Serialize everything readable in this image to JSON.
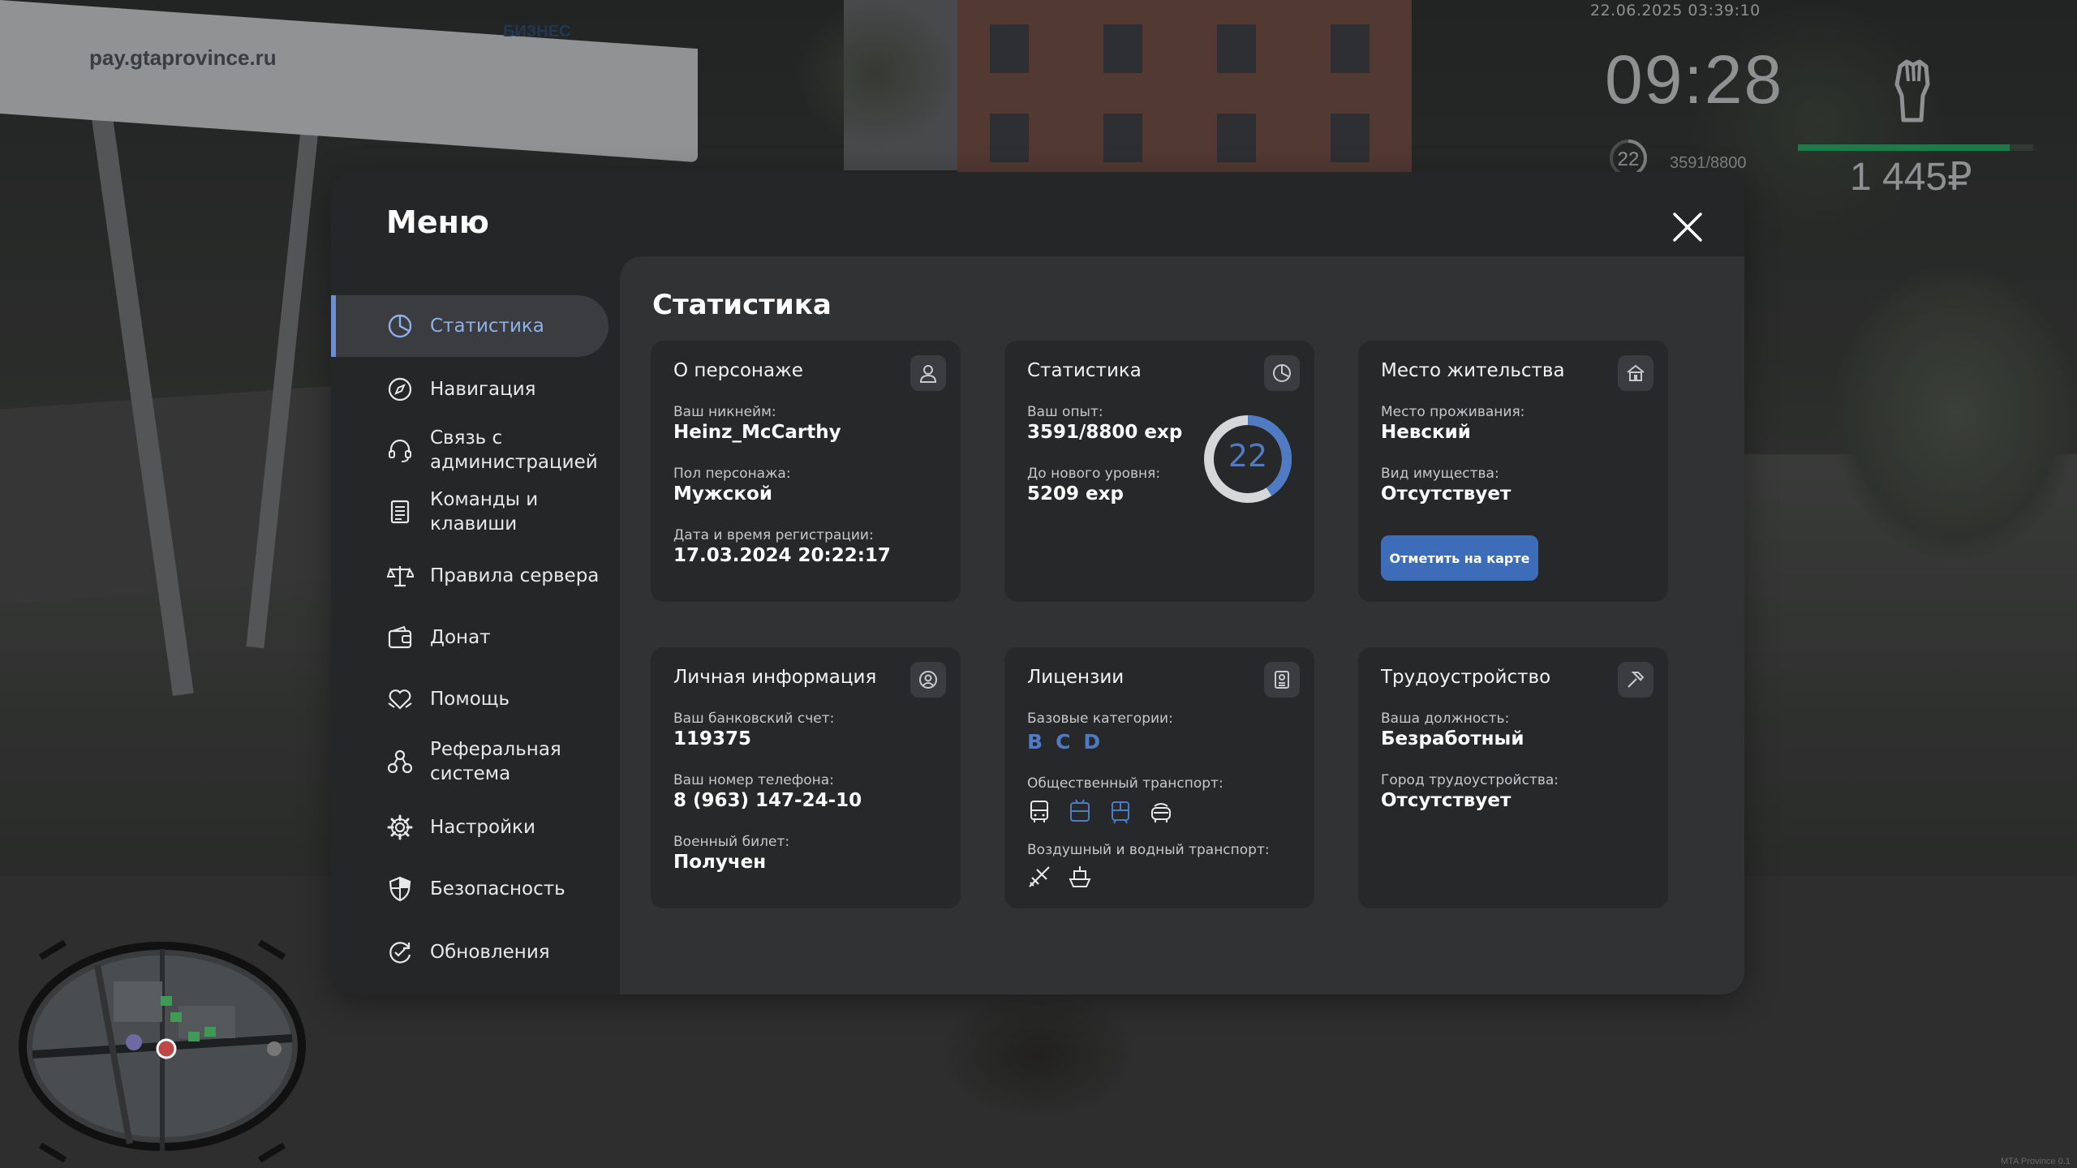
{
  "hud": {
    "datetime": "22.06.2025 03:39:10",
    "clock": "09:28",
    "level": "22",
    "exp": "3591/8800",
    "money": "1 445₽",
    "health_fraction": 0.9,
    "watermark": "MTA Province 0.1"
  },
  "background": {
    "billboard_text": "pay.gtaprovince.ru",
    "billboard_brand": "БИЗНЕС"
  },
  "menu": {
    "title": "Меню",
    "close_icon": "close-icon",
    "nav": [
      {
        "label": "Статистика",
        "icon": "chart-pie-icon",
        "active": true
      },
      {
        "label": "Навигация",
        "icon": "compass-icon"
      },
      {
        "label": "Связь с\nадминистрацией",
        "icon": "headset-icon"
      },
      {
        "label": "Команды и\nклавиши",
        "icon": "document-list-icon"
      },
      {
        "label": "Правила сервера",
        "icon": "scales-icon"
      },
      {
        "label": "Донат",
        "icon": "wallet-icon"
      },
      {
        "label": "Помощь",
        "icon": "heart-hands-icon"
      },
      {
        "label": "Реферальная\nсистема",
        "icon": "people-network-icon"
      },
      {
        "label": "Настройки",
        "icon": "gear-icon"
      },
      {
        "label": "Безопасность",
        "icon": "shield-icon"
      },
      {
        "label": "Обновления",
        "icon": "refresh-check-icon"
      }
    ]
  },
  "content": {
    "title": "Статистика",
    "character": {
      "title": "О персонаже",
      "icon": "user-icon",
      "nick_label": "Ваш никнейм:",
      "nick": "Heinz_McCarthy",
      "gender_label": "Пол персонажа:",
      "gender": "Мужской",
      "reg_label": "Дата и время регистрации:",
      "reg": "17.03.2024 20:22:17"
    },
    "stats": {
      "title": "Статистика",
      "icon": "clock-pie-icon",
      "exp_label": "Ваш опыт:",
      "exp": "3591/8800 exp",
      "next_label": "До нового уровня:",
      "next": "5209 exp",
      "level": "22",
      "progress": 0.408
    },
    "residence": {
      "title": "Место жительства",
      "icon": "home-icon",
      "place_label": "Место проживания:",
      "place": "Невский",
      "property_label": "Вид имущества:",
      "property": "Отсутствует",
      "button": "Отметить на карте"
    },
    "personal": {
      "title": "Личная информация",
      "icon": "user-circle-icon",
      "bank_label": "Ваш банковский счет:",
      "bank": "119375",
      "phone_label": "Ваш номер телефона:",
      "phone": "8 (963) 147-24-10",
      "military_label": "Военный билет:",
      "military": "Получен"
    },
    "licenses": {
      "title": "Лицензии",
      "icon": "id-card-icon",
      "base_label": "Базовые категории:",
      "categories": [
        "B",
        "C",
        "D"
      ],
      "public_label": "Общественный транспорт:",
      "public_icons": [
        "bus-icon",
        "trolleybus-icon",
        "tram-icon",
        "taxi-icon"
      ],
      "air_label": "Воздушный и водный транспорт:",
      "air_icons": [
        "plane-icon",
        "boat-icon"
      ]
    },
    "employment": {
      "title": "Трудоустройство",
      "icon": "hammer-icon",
      "position_label": "Ваша должность:",
      "position": "Безработный",
      "city_label": "Город трудоустройства:",
      "city": "Отсутствует"
    }
  }
}
